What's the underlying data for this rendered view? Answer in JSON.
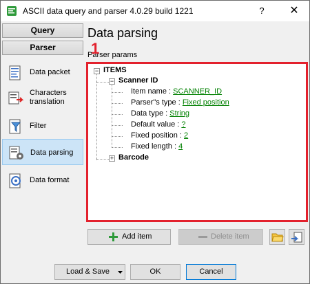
{
  "window": {
    "title": "ASCII data query and parser 4.0.29 build 1221",
    "help_glyph": "?",
    "close_glyph": "✕"
  },
  "sidebar": {
    "query_tab": "Query",
    "parser_tab": "Parser",
    "items": [
      {
        "label": "Data packet",
        "icon": "data-packet-icon"
      },
      {
        "label": "Characters translation",
        "icon": "characters-translation-icon"
      },
      {
        "label": "Filter",
        "icon": "filter-icon"
      },
      {
        "label": "Data parsing",
        "icon": "data-parsing-icon",
        "active": true
      },
      {
        "label": "Data format",
        "icon": "data-format-icon"
      }
    ]
  },
  "main": {
    "title": "Data parsing",
    "group_label": "Parser params",
    "annotation": "1",
    "tree": {
      "root": "ITEMS",
      "item1": {
        "name": "Scanner ID",
        "props": [
          {
            "label": "Item name : ",
            "value": "SCANNER_ID"
          },
          {
            "label": "Parser\"s type : ",
            "value": "Fixed position"
          },
          {
            "label": "Data type : ",
            "value": "String"
          },
          {
            "label": "Default value : ",
            "value": "?"
          },
          {
            "label": "Fixed position : ",
            "value": "2"
          },
          {
            "label": "Fixed length : ",
            "value": "4"
          }
        ]
      },
      "item2": {
        "name": "Barcode"
      }
    },
    "add_item": "Add item",
    "delete_item": "Delete item"
  },
  "footer": {
    "load_save": "Load & Save",
    "ok": "OK",
    "cancel": "Cancel"
  },
  "colors": {
    "accent_red": "#e3212d",
    "link_green": "#008000",
    "active_item_bg": "#cce4f7"
  }
}
